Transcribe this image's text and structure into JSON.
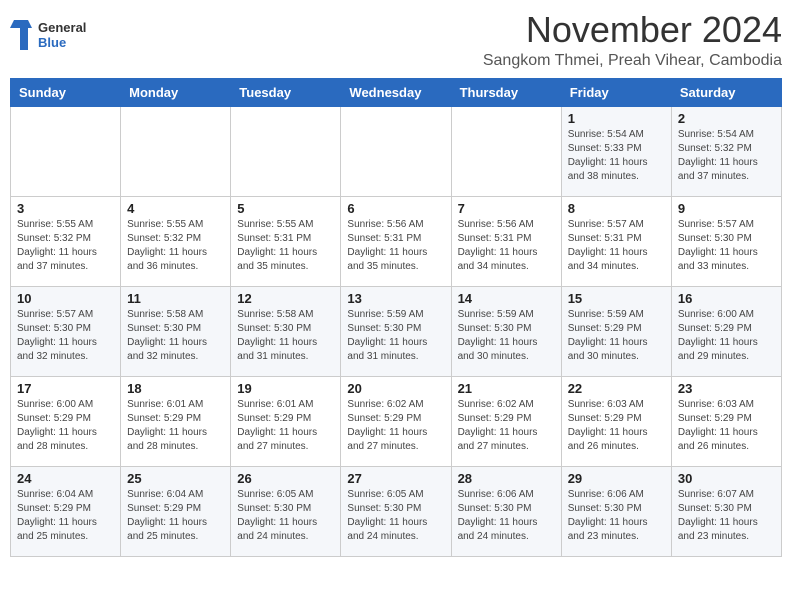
{
  "logo": {
    "line1": "General",
    "line2": "Blue"
  },
  "title": "November 2024",
  "location": "Sangkom Thmei, Preah Vihear, Cambodia",
  "weekdays": [
    "Sunday",
    "Monday",
    "Tuesday",
    "Wednesday",
    "Thursday",
    "Friday",
    "Saturday"
  ],
  "weeks": [
    [
      {
        "day": "",
        "info": ""
      },
      {
        "day": "",
        "info": ""
      },
      {
        "day": "",
        "info": ""
      },
      {
        "day": "",
        "info": ""
      },
      {
        "day": "",
        "info": ""
      },
      {
        "day": "1",
        "info": "Sunrise: 5:54 AM\nSunset: 5:33 PM\nDaylight: 11 hours\nand 38 minutes."
      },
      {
        "day": "2",
        "info": "Sunrise: 5:54 AM\nSunset: 5:32 PM\nDaylight: 11 hours\nand 37 minutes."
      }
    ],
    [
      {
        "day": "3",
        "info": "Sunrise: 5:55 AM\nSunset: 5:32 PM\nDaylight: 11 hours\nand 37 minutes."
      },
      {
        "day": "4",
        "info": "Sunrise: 5:55 AM\nSunset: 5:32 PM\nDaylight: 11 hours\nand 36 minutes."
      },
      {
        "day": "5",
        "info": "Sunrise: 5:55 AM\nSunset: 5:31 PM\nDaylight: 11 hours\nand 35 minutes."
      },
      {
        "day": "6",
        "info": "Sunrise: 5:56 AM\nSunset: 5:31 PM\nDaylight: 11 hours\nand 35 minutes."
      },
      {
        "day": "7",
        "info": "Sunrise: 5:56 AM\nSunset: 5:31 PM\nDaylight: 11 hours\nand 34 minutes."
      },
      {
        "day": "8",
        "info": "Sunrise: 5:57 AM\nSunset: 5:31 PM\nDaylight: 11 hours\nand 34 minutes."
      },
      {
        "day": "9",
        "info": "Sunrise: 5:57 AM\nSunset: 5:30 PM\nDaylight: 11 hours\nand 33 minutes."
      }
    ],
    [
      {
        "day": "10",
        "info": "Sunrise: 5:57 AM\nSunset: 5:30 PM\nDaylight: 11 hours\nand 32 minutes."
      },
      {
        "day": "11",
        "info": "Sunrise: 5:58 AM\nSunset: 5:30 PM\nDaylight: 11 hours\nand 32 minutes."
      },
      {
        "day": "12",
        "info": "Sunrise: 5:58 AM\nSunset: 5:30 PM\nDaylight: 11 hours\nand 31 minutes."
      },
      {
        "day": "13",
        "info": "Sunrise: 5:59 AM\nSunset: 5:30 PM\nDaylight: 11 hours\nand 31 minutes."
      },
      {
        "day": "14",
        "info": "Sunrise: 5:59 AM\nSunset: 5:30 PM\nDaylight: 11 hours\nand 30 minutes."
      },
      {
        "day": "15",
        "info": "Sunrise: 5:59 AM\nSunset: 5:29 PM\nDaylight: 11 hours\nand 30 minutes."
      },
      {
        "day": "16",
        "info": "Sunrise: 6:00 AM\nSunset: 5:29 PM\nDaylight: 11 hours\nand 29 minutes."
      }
    ],
    [
      {
        "day": "17",
        "info": "Sunrise: 6:00 AM\nSunset: 5:29 PM\nDaylight: 11 hours\nand 28 minutes."
      },
      {
        "day": "18",
        "info": "Sunrise: 6:01 AM\nSunset: 5:29 PM\nDaylight: 11 hours\nand 28 minutes."
      },
      {
        "day": "19",
        "info": "Sunrise: 6:01 AM\nSunset: 5:29 PM\nDaylight: 11 hours\nand 27 minutes."
      },
      {
        "day": "20",
        "info": "Sunrise: 6:02 AM\nSunset: 5:29 PM\nDaylight: 11 hours\nand 27 minutes."
      },
      {
        "day": "21",
        "info": "Sunrise: 6:02 AM\nSunset: 5:29 PM\nDaylight: 11 hours\nand 27 minutes."
      },
      {
        "day": "22",
        "info": "Sunrise: 6:03 AM\nSunset: 5:29 PM\nDaylight: 11 hours\nand 26 minutes."
      },
      {
        "day": "23",
        "info": "Sunrise: 6:03 AM\nSunset: 5:29 PM\nDaylight: 11 hours\nand 26 minutes."
      }
    ],
    [
      {
        "day": "24",
        "info": "Sunrise: 6:04 AM\nSunset: 5:29 PM\nDaylight: 11 hours\nand 25 minutes."
      },
      {
        "day": "25",
        "info": "Sunrise: 6:04 AM\nSunset: 5:29 PM\nDaylight: 11 hours\nand 25 minutes."
      },
      {
        "day": "26",
        "info": "Sunrise: 6:05 AM\nSunset: 5:30 PM\nDaylight: 11 hours\nand 24 minutes."
      },
      {
        "day": "27",
        "info": "Sunrise: 6:05 AM\nSunset: 5:30 PM\nDaylight: 11 hours\nand 24 minutes."
      },
      {
        "day": "28",
        "info": "Sunrise: 6:06 AM\nSunset: 5:30 PM\nDaylight: 11 hours\nand 24 minutes."
      },
      {
        "day": "29",
        "info": "Sunrise: 6:06 AM\nSunset: 5:30 PM\nDaylight: 11 hours\nand 23 minutes."
      },
      {
        "day": "30",
        "info": "Sunrise: 6:07 AM\nSunset: 5:30 PM\nDaylight: 11 hours\nand 23 minutes."
      }
    ]
  ]
}
